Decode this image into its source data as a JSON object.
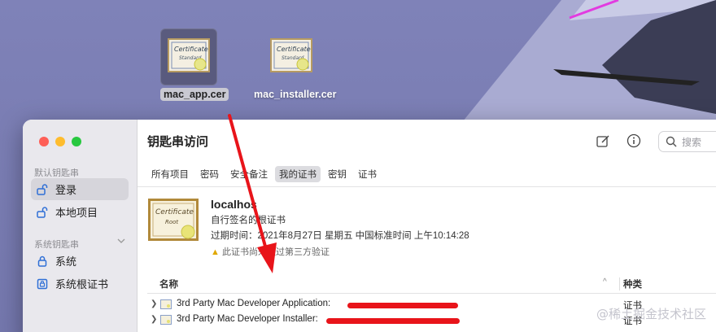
{
  "desktop": {
    "icons": [
      {
        "label": "mac_app.cer",
        "selected": true
      },
      {
        "label": "mac_installer.cer",
        "selected": false
      }
    ]
  },
  "window": {
    "title": "钥匙串访问",
    "search_placeholder": "搜索",
    "sidebar": {
      "section1": "默认钥匙串",
      "items1": [
        {
          "label": "登录",
          "icon": "unlock-icon",
          "active": true
        },
        {
          "label": "本地项目",
          "icon": "unlock-icon",
          "active": false
        }
      ],
      "section2": "系统钥匙串",
      "items2": [
        {
          "label": "系统",
          "icon": "lock-icon",
          "active": false
        },
        {
          "label": "系统根证书",
          "icon": "cabinet-icon",
          "active": false
        }
      ]
    },
    "tabs": [
      {
        "label": "所有项目",
        "active": false
      },
      {
        "label": "密码",
        "active": false
      },
      {
        "label": "安全备注",
        "active": false
      },
      {
        "label": "我的证书",
        "active": true
      },
      {
        "label": "密钥",
        "active": false
      },
      {
        "label": "证书",
        "active": false
      }
    ],
    "certificate": {
      "name": "localhos",
      "issuer": "自行签名的根证书",
      "expires": "过期时间：2021年8月27日 星期五 中国标准时间 上午10:14:28",
      "warning": "此证书尚未经过第三方验证",
      "icon_text_1": "Certificate",
      "icon_text_2": "Root"
    },
    "table": {
      "col_name": "名称",
      "col_kind": "种类",
      "sort_indicator": "^",
      "rows": [
        {
          "name": "3rd Party Mac Developer Application:",
          "kind": "证书"
        },
        {
          "name": "3rd Party Mac Developer Installer:",
          "kind": "证书"
        }
      ]
    }
  },
  "watermark": "@稀土掘金技术社区",
  "colors": {
    "annotation_red": "#e8141a",
    "selection": "#d6d5db"
  }
}
